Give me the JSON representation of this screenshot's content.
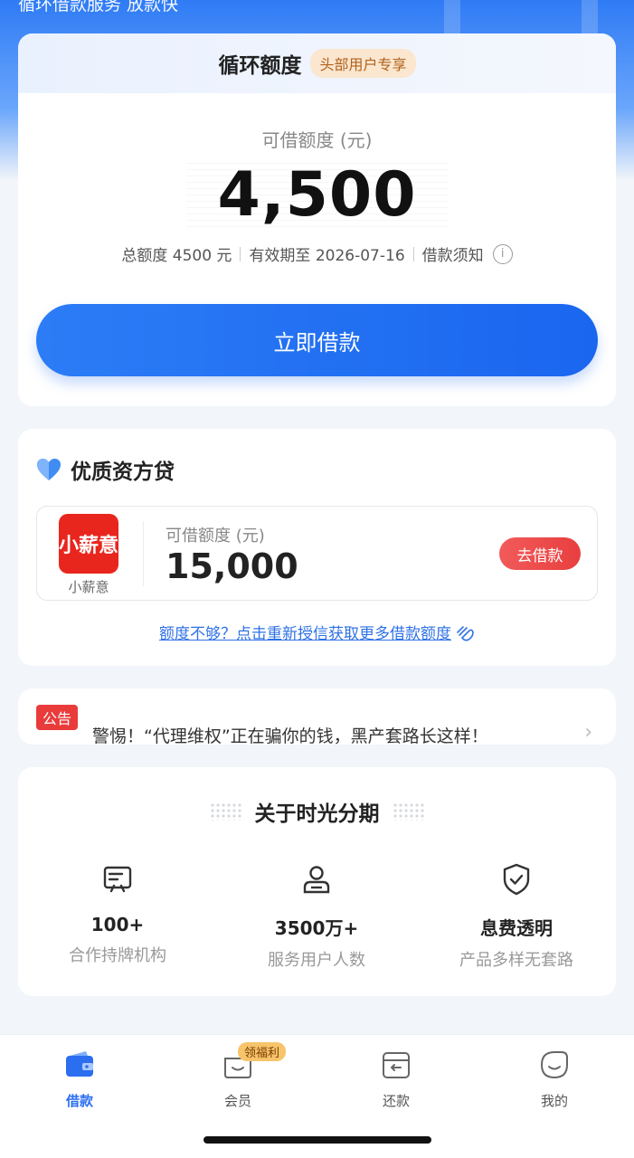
{
  "top": {
    "subtitle": "循环借款服务 放款快"
  },
  "credit": {
    "title": "循环额度",
    "tag": "头部用户专享",
    "available_label": "可借额度 (元)",
    "amount": "4,500",
    "total": "总额度 4500 元",
    "valid_until": "有效期至 2026-07-16",
    "notice_link": "借款须知",
    "button": "立即借款"
  },
  "lender": {
    "title": "优质资方贷",
    "logo_text": "小薪意",
    "name": "小薪意",
    "amount_label": "可借额度 (元)",
    "amount": "15,000",
    "button": "去借款",
    "more_link": "额度不够？点击重新授信获取更多借款额度"
  },
  "notice": {
    "tag": "公告",
    "text": "警惕！“代理维权”正在骗你的钱，黑产套路长这样！"
  },
  "about": {
    "title": "关于时光分期",
    "features": [
      {
        "icon": "institution-icon",
        "value": "100+",
        "desc": "合作持牌机构"
      },
      {
        "icon": "user-icon",
        "value": "3500万+",
        "desc": "服务用户人数"
      },
      {
        "icon": "shield-check-icon",
        "value": "息费透明",
        "desc": "产品多样无套路"
      }
    ]
  },
  "nav": {
    "items": [
      {
        "label": "借款",
        "icon": "wallet-icon",
        "active": true
      },
      {
        "label": "会员",
        "icon": "member-icon",
        "active": false
      },
      {
        "label": "还款",
        "icon": "repay-icon",
        "active": false
      },
      {
        "label": "我的",
        "icon": "profile-icon",
        "active": false
      }
    ],
    "badge": "领福利"
  },
  "colors": {
    "primary": "#2c6ef0",
    "danger": "#ea3b3b",
    "tag_bg": "#fbe6cf"
  }
}
